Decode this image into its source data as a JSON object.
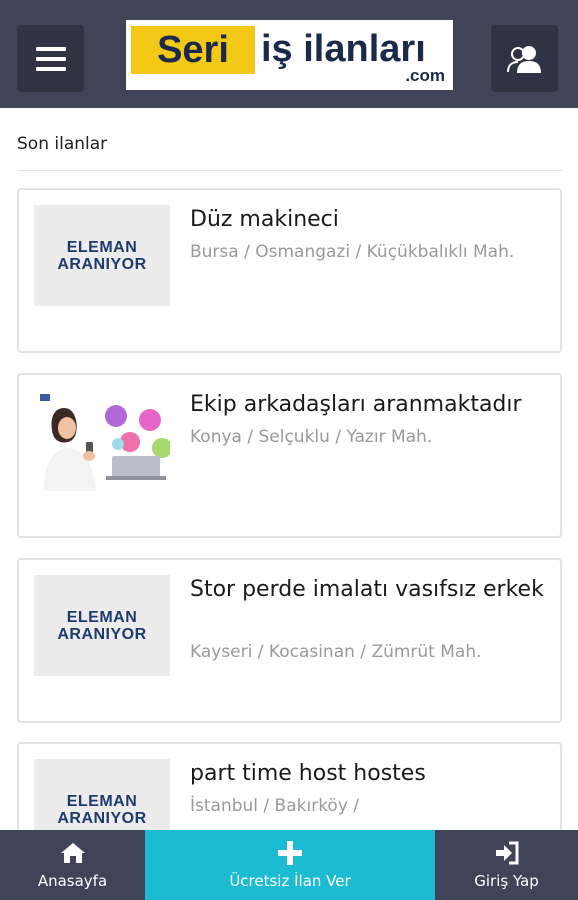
{
  "header": {
    "logo": {
      "part1": "Seri",
      "part2": "iş ilanları",
      "suffix": ".com"
    },
    "menu_icon": "hamburger-menu-icon",
    "user_icon": "users-icon"
  },
  "section": {
    "title": "Son ilanlar"
  },
  "listings": [
    {
      "thumb_type": "placeholder",
      "thumb_line1": "ELEMAN",
      "thumb_line2": "ARANIYOR",
      "title": "Düz makineci",
      "location": "Bursa / Osmangazi / Küçükbalıklı Mah."
    },
    {
      "thumb_type": "photo",
      "thumb_line1": "",
      "thumb_line2": "",
      "title": "Ekip arkadaşları aranmaktadır",
      "location": "Konya / Selçuklu / Yazır Mah."
    },
    {
      "thumb_type": "placeholder",
      "thumb_line1": "ELEMAN",
      "thumb_line2": "ARANIYOR",
      "title": "Stor perde imalatı vasıfsız erkek",
      "location": "Kayseri / Kocasinan / Zümrüt Mah."
    },
    {
      "thumb_type": "placeholder",
      "thumb_line1": "ELEMAN",
      "thumb_line2": "ARANIYOR",
      "title": "part time host hostes",
      "location": "İstanbul / Bakırköy /"
    }
  ],
  "bottom_nav": {
    "home": {
      "label": "Anasayfa",
      "icon": "home-icon"
    },
    "post": {
      "label": "Ücretsiz İlan Ver",
      "icon": "plus-icon"
    },
    "login": {
      "label": "Giriş Yap",
      "icon": "sign-in-icon"
    }
  },
  "colors": {
    "header_bg": "#3f4459",
    "accent": "#1bbcd3",
    "logo_yellow": "#f4c816",
    "logo_navy": "#1b2a4a"
  }
}
